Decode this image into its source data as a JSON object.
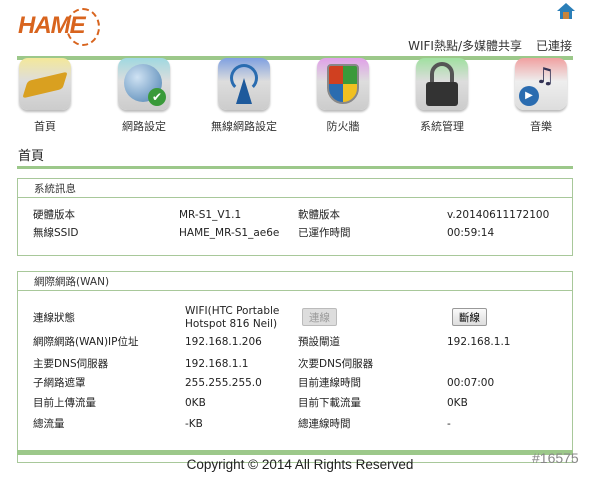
{
  "header": {
    "logo": "HAME",
    "product": "WIFI熱點/多媒體共享",
    "connection_status": "已連接"
  },
  "nav": [
    {
      "label": "首頁",
      "icon": "home-rss-icon"
    },
    {
      "label": "網路設定",
      "icon": "globe-check-icon"
    },
    {
      "label": "無線網路設定",
      "icon": "wireless-tower-icon"
    },
    {
      "label": "防火牆",
      "icon": "shield-icon"
    },
    {
      "label": "系統管理",
      "icon": "lock-gear-icon"
    },
    {
      "label": "音樂",
      "icon": "music-play-icon"
    }
  ],
  "page_title": "首頁",
  "system_info": {
    "title": "系統訊息",
    "rows": [
      {
        "l1": "硬體版本",
        "v1": "MR-S1_V1.1",
        "l2": "軟體版本",
        "v2": "v.20140611172100"
      },
      {
        "l1": "無線SSID",
        "v1": "HAME_MR-S1_ae6e",
        "l2": "已運作時間",
        "v2": "00:59:14"
      }
    ]
  },
  "wan": {
    "title": "網際網路(WAN)",
    "status_label": "連線狀態",
    "status_value_line1": "WIFI(HTC Portable",
    "status_value_line2": "Hotspot 816 Neil)",
    "connect_button": "連線",
    "disconnect_button": "斷線",
    "rows": [
      {
        "l1": "網際網路(WAN)IP位址",
        "v1": "192.168.1.206",
        "l2": "預設閘道",
        "v2": "192.168.1.1"
      },
      {
        "l1": "主要DNS伺服器",
        "v1": "192.168.1.1",
        "l2": "次要DNS伺服器",
        "v2": ""
      },
      {
        "l1": "子網路遮罩",
        "v1": "255.255.255.0",
        "l2": "目前連線時間",
        "v2": "00:07:00"
      },
      {
        "l1": "目前上傳流量",
        "v1": "0KB",
        "l2": "目前下載流量",
        "v2": "0KB"
      },
      {
        "l1": "總流量",
        "v1": "-KB",
        "l2": "總連線時間",
        "v2": "-"
      }
    ]
  },
  "footer": {
    "copyright": "Copyright © 2014 All Rights Reserved"
  },
  "watermark": "#16575",
  "colors": {
    "accent_green": "#9cc88a",
    "logo_orange": "#d8641e"
  }
}
